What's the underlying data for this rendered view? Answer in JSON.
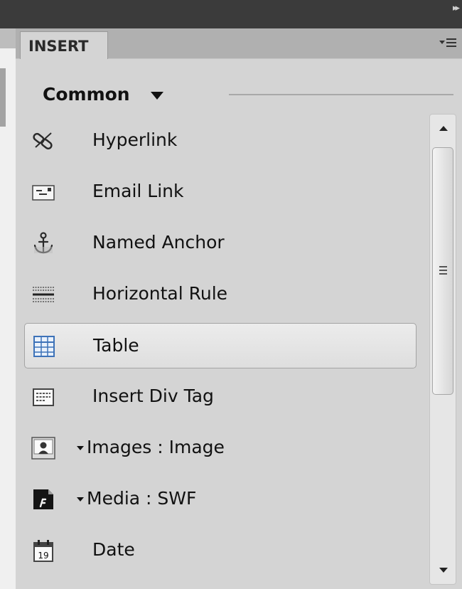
{
  "panel": {
    "tab_label": "INSERT",
    "category": "Common"
  },
  "items": [
    {
      "label": "Hyperlink",
      "icon": "hyperlink-icon"
    },
    {
      "label": "Email Link",
      "icon": "email-link-icon"
    },
    {
      "label": "Named Anchor",
      "icon": "named-anchor-icon"
    },
    {
      "label": "Horizontal Rule",
      "icon": "horizontal-rule-icon"
    },
    {
      "label": "Table",
      "icon": "table-icon",
      "selected": true
    },
    {
      "label": "Insert Div Tag",
      "icon": "insert-div-tag-icon"
    },
    {
      "label": "Images : Image",
      "icon": "image-icon",
      "dropdown": true
    },
    {
      "label": "Media : SWF",
      "icon": "swf-media-icon",
      "dropdown": true
    },
    {
      "label": "Date",
      "icon": "date-icon",
      "date_number": "19"
    }
  ],
  "colors": {
    "panel_bg": "#d4d4d4",
    "tab_strip_bg": "#b0b0b0",
    "title_bar_bg": "#3b3b3b",
    "table_icon_blue": "#3d72b8"
  }
}
